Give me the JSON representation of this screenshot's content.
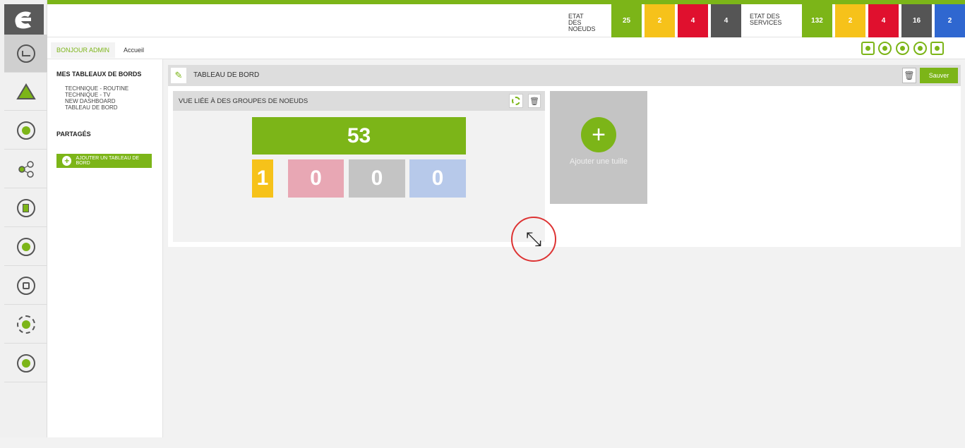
{
  "top": {
    "nodes_label": "ETAT DES NOEUDS",
    "node_counts": [
      "25",
      "2",
      "4",
      "4"
    ],
    "services_label": "ETAT DES SERVICES",
    "service_counts": [
      "132",
      "2",
      "4",
      "16",
      "2"
    ]
  },
  "header": {
    "hello": "BONJOUR ADMIN",
    "breadcrumb": "Accueil"
  },
  "sidebar": {
    "my_boards": "MES TABLEAUX DE BORDS",
    "boards": [
      "TECHNIQUE - ROUTINE",
      "TECHNIQUE - TV",
      "NEW DASHBOARD",
      "TABLEAU DE BORD"
    ],
    "shared": "PARTAGÉS",
    "add_board": "AJOUTER UN TABLEAU DE BORD"
  },
  "board": {
    "title": "TABLEAU DE BORD",
    "save": "Sauver"
  },
  "tile": {
    "title": "VUE LIÉE À DES GROUPES DE NOEUDS",
    "total": "53",
    "counts": [
      "1",
      "0",
      "0",
      "0"
    ]
  },
  "add_tile": {
    "label": "Ajouter une tuille"
  },
  "colors": {
    "green": "#7cb518",
    "yellow": "#f6c21a",
    "red": "#e0102e",
    "dark": "#555555",
    "blue": "#2f67d0",
    "pink": "#e8a7b4",
    "grey": "#c4c4c4",
    "lightblue": "#b7c9ea"
  },
  "icons": [
    "logo-icon",
    "dashboard-icon",
    "alert-icon",
    "history-icon",
    "share-icon",
    "report-icon",
    "satellite-icon",
    "topology-icon",
    "settings-icon",
    "info-icon",
    "user-icon",
    "mail-icon",
    "search-icon",
    "help-icon",
    "lock-icon",
    "pencil-icon",
    "trash-icon",
    "gear-icon",
    "plus-icon",
    "resize-cursor-icon"
  ]
}
